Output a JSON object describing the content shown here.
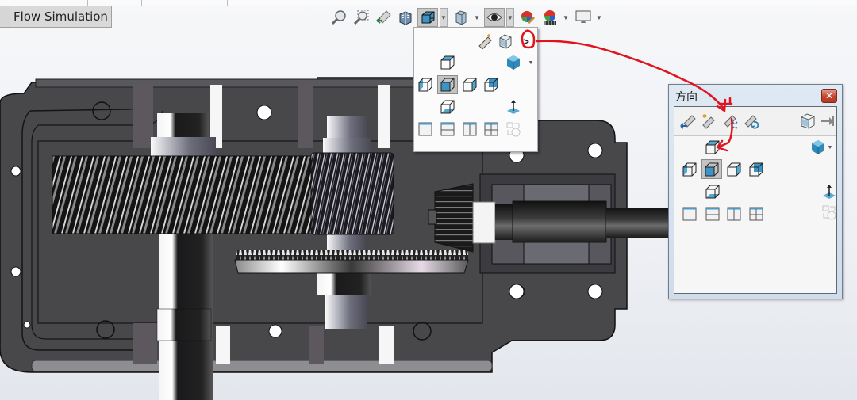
{
  "tabs": {
    "active_tab": "Flow Simulation"
  },
  "heads_up_toolbar": {
    "items": [
      {
        "name": "zoom-to-fit",
        "icon": "magnifier-icon"
      },
      {
        "name": "zoom-to-area",
        "icon": "zoom-area-icon"
      },
      {
        "name": "previous-view",
        "icon": "previous-view-icon"
      },
      {
        "name": "section-view",
        "icon": "section-view-icon"
      },
      {
        "name": "view-orientation",
        "icon": "view-orientation-cube-icon",
        "has_dropdown": true,
        "pressed": true
      },
      {
        "name": "display-style",
        "icon": "display-style-icon",
        "has_dropdown": true
      },
      {
        "name": "hide-show-items",
        "icon": "eye-icon",
        "has_dropdown": true,
        "pressed": true
      },
      {
        "name": "edit-appearance",
        "icon": "edit-appearance-icon"
      },
      {
        "name": "apply-scene",
        "icon": "scene-icon",
        "has_dropdown": true
      },
      {
        "name": "view-settings",
        "icon": "monitor-icon",
        "has_dropdown": true
      }
    ]
  },
  "orientation_flyout": {
    "top_row": [
      "view-selector-icon",
      "new-view-icon",
      "expand-chevron-icon"
    ],
    "expand_glyph": ">",
    "standard_views": [
      "top",
      "left",
      "front",
      "right",
      "back",
      "bottom"
    ],
    "selected_view": "front",
    "isometric": "isometric-icon",
    "normal_to": "normal-to-icon",
    "viewports": [
      "single-view",
      "two-view-horizontal",
      "two-view-vertical",
      "four-view",
      "link-views"
    ]
  },
  "orientation_dialog": {
    "title": "方向",
    "close_glyph": "✕",
    "toolbar": [
      "previous-view-icon",
      "new-view-icon",
      "update-standard-views-icon",
      "reset-standard-views-icon",
      "view-selector-icon",
      "pin-icon"
    ],
    "standard_views": [
      "top",
      "left",
      "front",
      "right",
      "back",
      "bottom"
    ],
    "selected_view": "front",
    "viewports": [
      "single-view",
      "two-view-horizontal",
      "two-view-vertical",
      "four-view",
      "link-views"
    ]
  },
  "annotation": {
    "color": "#e0141e",
    "description": "Red hand-drawn arrows pointing from flyout expand button to Orientation dialog, then to update-standard-views and top view"
  }
}
